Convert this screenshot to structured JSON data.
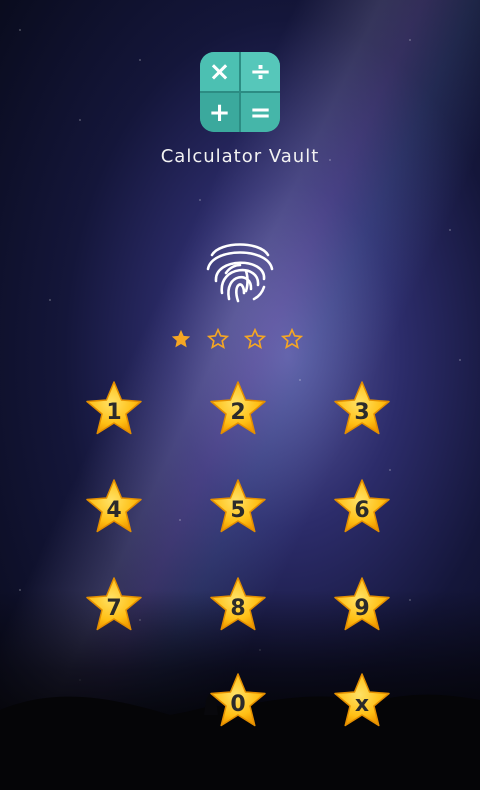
{
  "app": {
    "title": "Calculator Vault",
    "icon_symbols": [
      "×",
      "÷",
      "+",
      "="
    ]
  },
  "pin": {
    "length": 4,
    "entered": 1,
    "filled_color": "#f5a623",
    "empty_color": "#f5a623"
  },
  "keypad": {
    "keys": [
      "1",
      "2",
      "3",
      "4",
      "5",
      "6",
      "7",
      "8",
      "9",
      "0",
      "x"
    ],
    "star_color": "#ffc21a"
  }
}
